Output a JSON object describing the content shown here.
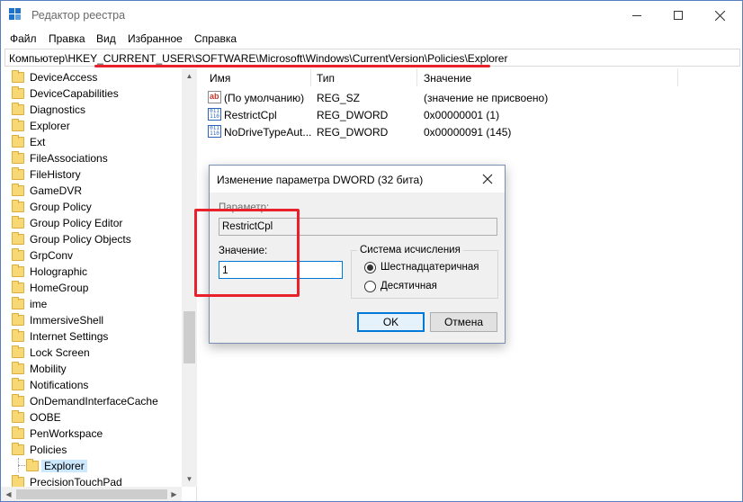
{
  "window": {
    "title": "Редактор реестра"
  },
  "menu": [
    "Файл",
    "Правка",
    "Вид",
    "Избранное",
    "Справка"
  ],
  "address": {
    "path": "Компьютер\\HKEY_CURRENT_USER\\SOFTWARE\\Microsoft\\Windows\\CurrentVersion\\Policies\\Explorer"
  },
  "tree": {
    "items": [
      "DeviceAccess",
      "DeviceCapabilities",
      "Diagnostics",
      "Explorer",
      "Ext",
      "FileAssociations",
      "FileHistory",
      "GameDVR",
      "Group Policy",
      "Group Policy Editor",
      "Group Policy Objects",
      "GrpConv",
      "Holographic",
      "HomeGroup",
      "ime",
      "ImmersiveShell",
      "Internet Settings",
      "Lock Screen",
      "Mobility",
      "Notifications",
      "OnDemandInterfaceCache",
      "OOBE",
      "PenWorkspace",
      "Policies"
    ],
    "child_selected": "Explorer",
    "last_partial": "PrecisionTouchPad"
  },
  "list": {
    "headers": {
      "name": "Имя",
      "type": "Тип",
      "value": "Значение"
    },
    "rows": [
      {
        "icon": "string-value-icon",
        "name": "(По умолчанию)",
        "type": "REG_SZ",
        "value": "(значение не присвоено)"
      },
      {
        "icon": "binary-value-icon",
        "name": "RestrictCpl",
        "type": "REG_DWORD",
        "value": "0x00000001 (1)"
      },
      {
        "icon": "binary-value-icon",
        "name": "NoDriveTypeAut...",
        "type": "REG_DWORD",
        "value": "0x00000091 (145)"
      }
    ]
  },
  "dialog": {
    "title": "Изменение параметра DWORD (32 бита)",
    "param_label": "Параметр:",
    "param_value": "RestrictCpl",
    "value_label": "Значение:",
    "value": "1",
    "base_title": "Система исчисления",
    "hex_label": "Шестнадцатеричная",
    "dec_label": "Десятичная",
    "selected_base": "hex",
    "ok": "OK",
    "cancel": "Отмена"
  },
  "colors": {
    "accent": "#0078d7",
    "highlight": "#e8212b",
    "folder": "#f8d775"
  }
}
